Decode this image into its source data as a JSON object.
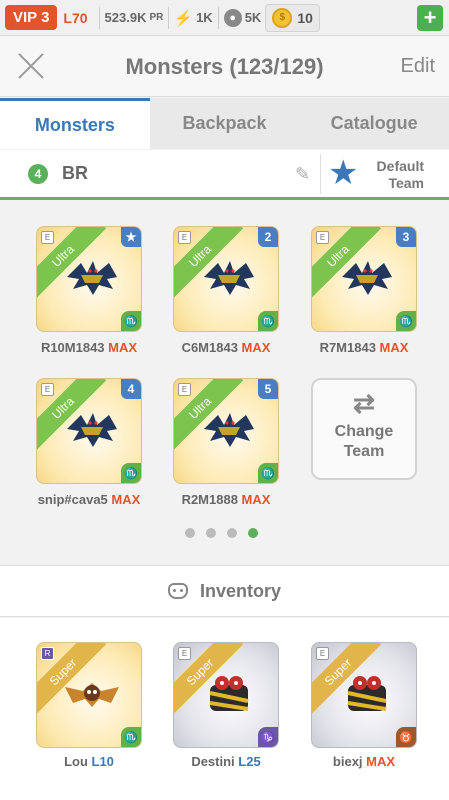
{
  "topbar": {
    "vip": "VIP 3",
    "level": "L70",
    "power": "523.9K",
    "power_unit": "PR",
    "energy": "1K",
    "food": "5K",
    "gold": "10"
  },
  "header": {
    "title": "Monsters (123/129)",
    "edit": "Edit"
  },
  "tabs": [
    "Monsters",
    "Backpack",
    "Catalogue"
  ],
  "team": {
    "number": "4",
    "name": "BR",
    "default_line1": "Default",
    "default_line2": "Team"
  },
  "team_monsters": [
    {
      "name": "R10M1843",
      "tag": "MAX",
      "rarity": "Ultra",
      "slot": "★",
      "element": "♏"
    },
    {
      "name": "C6M1843",
      "tag": "MAX",
      "rarity": "Ultra",
      "slot": "2",
      "element": "♏"
    },
    {
      "name": "R7M1843",
      "tag": "MAX",
      "rarity": "Ultra",
      "slot": "3",
      "element": "♏"
    },
    {
      "name": "snip#cava5",
      "tag": "MAX",
      "rarity": "Ultra",
      "slot": "4",
      "element": "♏"
    },
    {
      "name": "R2M1888",
      "tag": "MAX",
      "rarity": "Ultra",
      "slot": "5",
      "element": "♏"
    }
  ],
  "change_team": {
    "line1": "Change",
    "line2": "Team"
  },
  "pagination": {
    "pages": 4,
    "current": 4
  },
  "inventory": {
    "label": "Inventory",
    "items": [
      {
        "name": "Lou",
        "tag": "L10",
        "rarity": "Super",
        "tier": "R",
        "element": "♏"
      },
      {
        "name": "Destini",
        "tag": "L25",
        "rarity": "Super",
        "tier": "E",
        "element": "♑"
      },
      {
        "name": "biexj",
        "tag": "MAX",
        "rarity": "Super",
        "tier": "E",
        "element": "♉"
      }
    ]
  }
}
